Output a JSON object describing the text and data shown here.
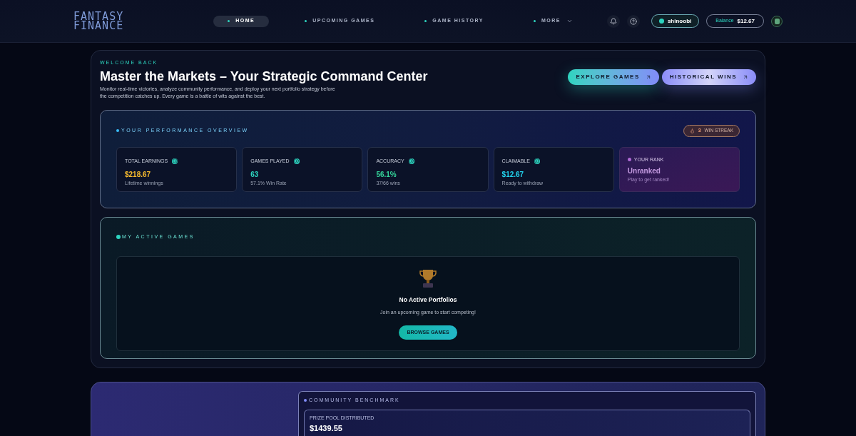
{
  "logo": {
    "line_1": "FANTASY",
    "line_2": "FINANCE"
  },
  "nav": [
    {
      "label": "HOME",
      "selected": true,
      "kind": "link"
    },
    {
      "label": "UPCOMING GAMES",
      "selected": false,
      "kind": "link"
    },
    {
      "label": "GAME HISTORY",
      "selected": false,
      "kind": "link"
    },
    {
      "label": "MORE",
      "selected": false,
      "kind": "dropdown"
    }
  ],
  "user": {
    "name": "shinoobi",
    "balance_label": "Balance",
    "balance": "$12.67"
  },
  "hero": {
    "eyebrow": "WELCOME BACK",
    "title": "Master the Markets – Your Strategic Command Center",
    "description": "Monitor real-time victories, analyze community performance, and deploy your next portfolio strategy before the competition catches up. Every game is a battle of wits against the best.",
    "buttons": [
      {
        "label": "EXPLORE GAMES",
        "kind": "primary"
      },
      {
        "label": "HISTORICAL WINS",
        "kind": "secondary"
      }
    ]
  },
  "performance": {
    "title": "YOUR PERFORMANCE OVERVIEW",
    "streak": {
      "count": "3",
      "label": "WIN STREAK"
    },
    "stats": [
      {
        "label": "TOTAL EARNINGS",
        "value": "$218.67",
        "caption": "Lifetime winnings",
        "color": "#f5b92e"
      },
      {
        "label": "GAMES PLAYED",
        "value": "63",
        "caption": "57.1% Win Rate",
        "color": "#2dd4bf"
      },
      {
        "label": "ACCURACY",
        "value": "56.1%",
        "caption": "37/66 wins",
        "color": "#34d399"
      },
      {
        "label": "CLAIMABLE",
        "value": "$12.67",
        "caption": "Ready to withdraw",
        "color": "#22d3ee"
      }
    ],
    "rank": {
      "label": "YOUR RANK",
      "value": "Unranked",
      "caption": "Play to get ranked!"
    }
  },
  "active_games": {
    "title": "MY ACTIVE GAMES",
    "empty_title": "No Active Portfolios",
    "empty_text": "Join an upcoming game to start competing!",
    "button": "BROWSE GAMES"
  },
  "community": {
    "title": "COMMUNITY BENCHMARK",
    "prize_label": "PRIZE POOL DISTRIBUTED",
    "prize_value": "$1439.55"
  }
}
